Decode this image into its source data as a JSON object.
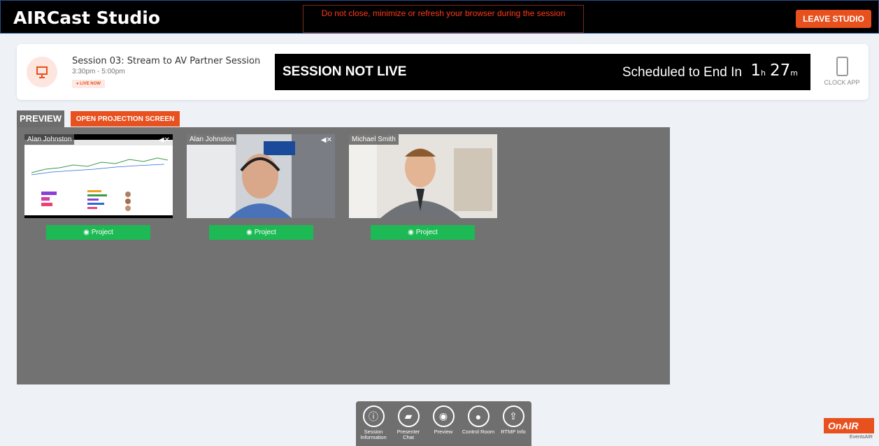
{
  "header": {
    "title": "AIRCast Studio",
    "warning": "Do not close, minimize or refresh your browser during the session",
    "leave_label": "LEAVE STUDIO"
  },
  "session": {
    "name": "Session 03: Stream to AV Partner Session",
    "time": "3:30pm - 5:00pm",
    "badge": "● LIVE NOW",
    "status": "SESSION NOT LIVE",
    "end_label": "Scheduled to End In",
    "hours": "1",
    "hours_unit": "h",
    "minutes": "27",
    "minutes_unit": "m",
    "clock_app": "CLOCK APP"
  },
  "tabs": {
    "preview": "PREVIEW",
    "projection": "OPEN PROJECTION SCREEN"
  },
  "participants": [
    {
      "name": "Alan Johnston",
      "project_label": "Project"
    },
    {
      "name": "Alan Johnston",
      "project_label": "Project"
    },
    {
      "name": "Michael Smith",
      "project_label": "Project"
    }
  ],
  "toolbar": [
    {
      "label": "Session Information",
      "icon": "info-icon"
    },
    {
      "label": "Presenter Chat",
      "icon": "chat-icon"
    },
    {
      "label": "Preview",
      "icon": "eye-icon"
    },
    {
      "label": "Control Room",
      "icon": "user-icon"
    },
    {
      "label": "RTMP Info",
      "icon": "upload-icon"
    }
  ],
  "logo": {
    "brand": "OnAIR",
    "sub": "EventsAIR"
  },
  "colors": {
    "accent": "#e8501e",
    "project": "#1db954",
    "preview_bg": "#727272"
  }
}
